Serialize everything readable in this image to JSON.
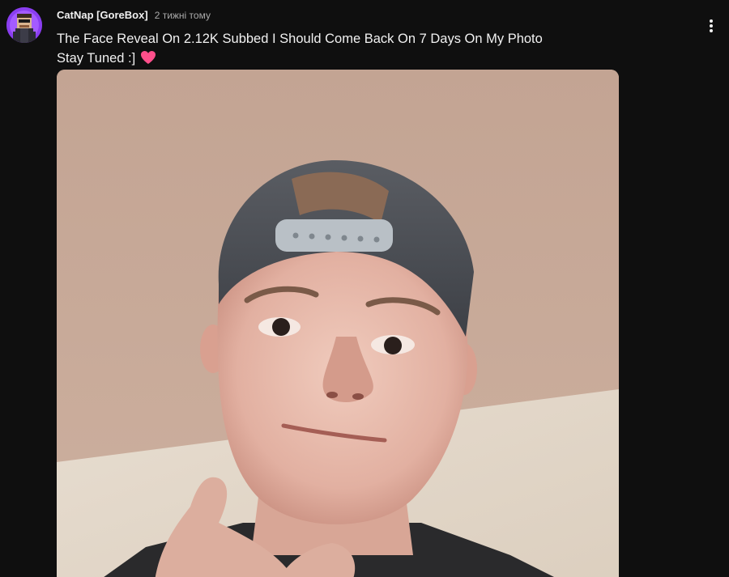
{
  "post": {
    "author": "CatNap [GoreBox]",
    "time": "2 тижні тому",
    "text_line1": "The Face Reveal On 2.12K Subbed I Should Come Back On 7 Days On My Photo",
    "text_line2": "Stay Tuned :]"
  },
  "icons": {
    "avatar": "pixel-character-avatar",
    "heart": "pink-heart-emoji",
    "menu": "more-vert-icon"
  },
  "colors": {
    "background": "#0f0f0f",
    "text_primary": "#f1f1f1",
    "text_secondary": "#aaaaaa",
    "heart": "#ff4f8b",
    "avatar_bg": "#7a2fd8"
  }
}
